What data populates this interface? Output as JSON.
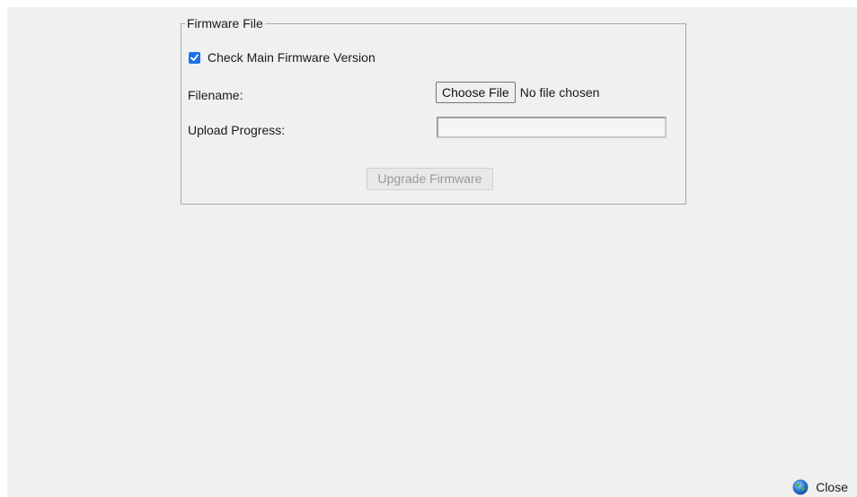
{
  "firmware_panel": {
    "legend": "Firmware File",
    "check_main": {
      "label": "Check Main Firmware Version",
      "checked": true
    },
    "filename": {
      "label": "Filename:",
      "button_label": "Choose File",
      "status_text": "No file chosen"
    },
    "upload_progress": {
      "label": "Upload Progress:",
      "value_percent": 0
    },
    "upgrade_button": {
      "label": "Upgrade Firmware",
      "enabled": false
    }
  },
  "footer": {
    "close_label": "Close",
    "close_icon": "close-globe-icon"
  },
  "colors": {
    "background": "#f0f0f0",
    "checkbox_accent": "#1a73e8",
    "disabled_text": "#9a9a9a"
  }
}
